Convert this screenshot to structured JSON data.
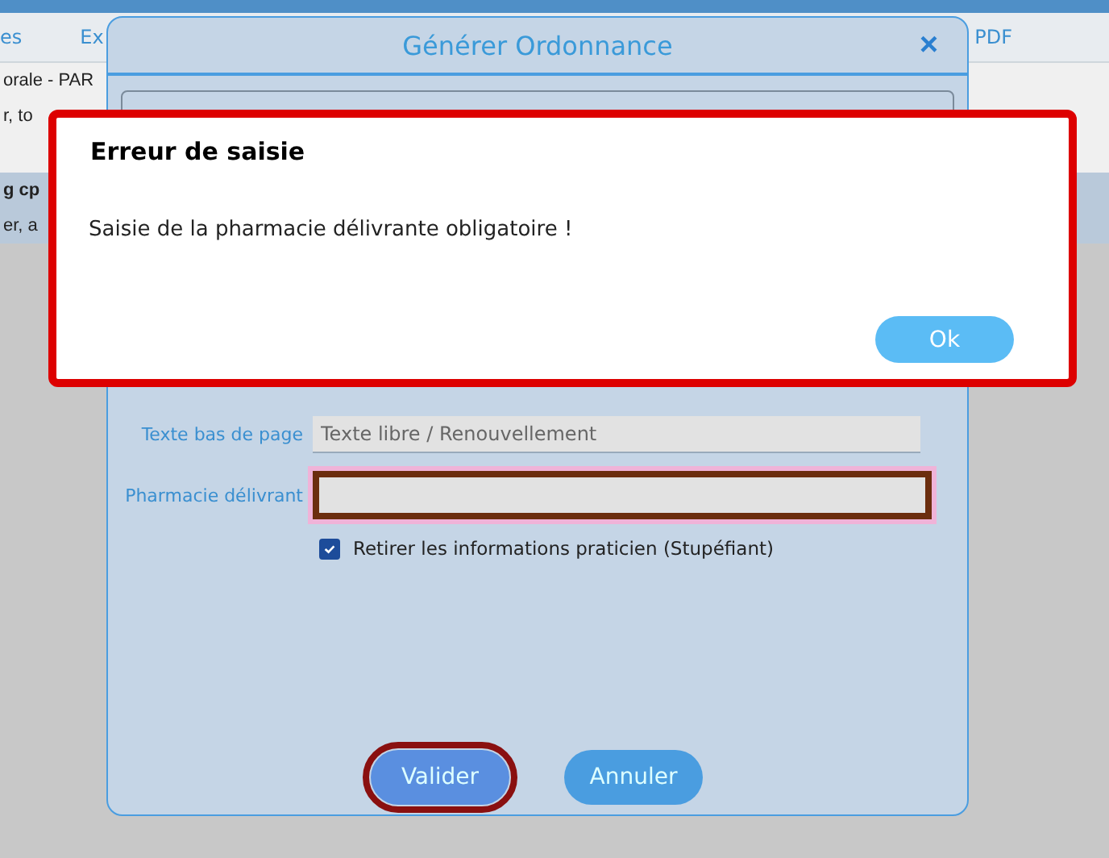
{
  "background": {
    "toolbar": [
      "es",
      "Ex",
      "PDF"
    ],
    "rows": [
      {
        "text": "orale - PAR",
        "selected": false,
        "bold": false
      },
      {
        "text": "r, to",
        "selected": false,
        "bold": false
      },
      {
        "text": "g cp",
        "selected": true,
        "bold": true
      },
      {
        "text": "er, a",
        "selected": true,
        "bold": false
      }
    ]
  },
  "dialog": {
    "title": "Générer Ordonnance",
    "close": "×",
    "fields": [
      {
        "label": "Texte bas de page",
        "placeholder": "Texte libre / Renouvellement",
        "error": false
      },
      {
        "label": "Pharmacie délivrant",
        "error": true
      }
    ],
    "checkbox": {
      "label": "Retirer les informations praticien (Stupéfiant)",
      "checked": true
    },
    "buttons": [
      {
        "label": "Valider",
        "highlighted": true
      },
      {
        "label": "Annuler",
        "highlighted": false
      }
    ]
  },
  "error_dialog": {
    "title": "Erreur de saisie",
    "message": "Saisie de la pharmacie délivrante obligatoire !",
    "button": "Ok"
  }
}
